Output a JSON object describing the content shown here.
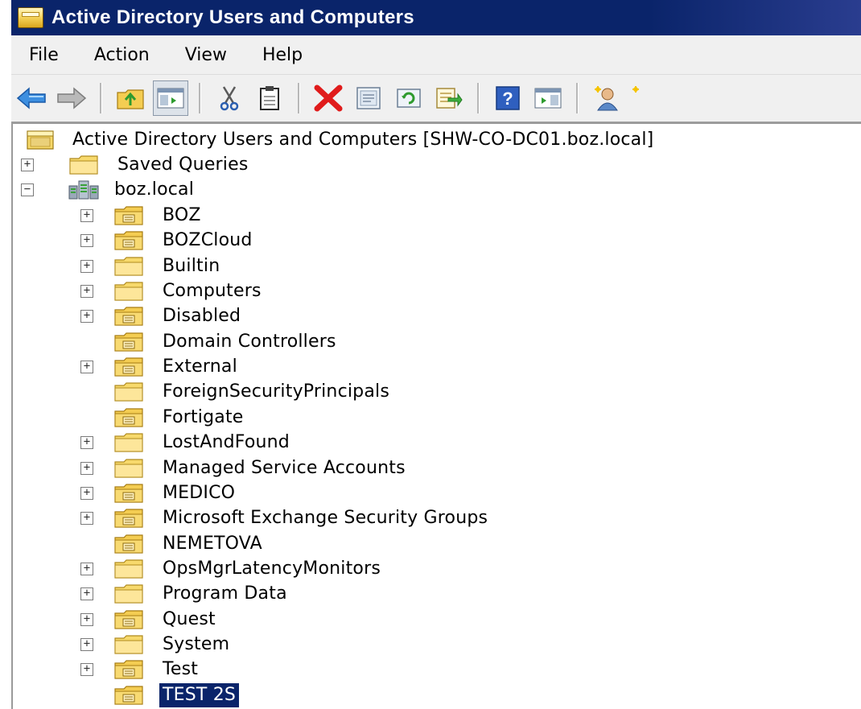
{
  "window": {
    "title": "Active Directory Users and Computers"
  },
  "menu": {
    "items": [
      "File",
      "Action",
      "View",
      "Help"
    ]
  },
  "toolbar": {
    "buttons": [
      {
        "name": "back-icon"
      },
      {
        "name": "forward-icon"
      },
      {
        "name": "up-folder-icon"
      },
      {
        "name": "show-hide-tree-icon"
      },
      {
        "name": "cut-icon"
      },
      {
        "name": "paste-icon"
      },
      {
        "name": "delete-icon"
      },
      {
        "name": "properties-icon"
      },
      {
        "name": "refresh-icon"
      },
      {
        "name": "export-list-icon"
      },
      {
        "name": "help-icon"
      },
      {
        "name": "show-action-pane-icon"
      },
      {
        "name": "new-user-icon"
      }
    ]
  },
  "tree": {
    "root": {
      "label": "Active Directory Users and Computers [SHW-CO-DC01.boz.local]"
    },
    "saved_queries": {
      "label": "Saved Queries",
      "expanded": false
    },
    "domain": {
      "label": "boz.local",
      "expanded": true
    },
    "children": [
      {
        "label": "BOZ",
        "kind": "ou",
        "expandable": true
      },
      {
        "label": "BOZCloud",
        "kind": "ou",
        "expandable": true
      },
      {
        "label": "Builtin",
        "kind": "container",
        "expandable": true
      },
      {
        "label": "Computers",
        "kind": "container",
        "expandable": true
      },
      {
        "label": "Disabled",
        "kind": "ou",
        "expandable": true
      },
      {
        "label": "Domain Controllers",
        "kind": "ou",
        "expandable": false
      },
      {
        "label": "External",
        "kind": "ou",
        "expandable": true
      },
      {
        "label": "ForeignSecurityPrincipals",
        "kind": "container",
        "expandable": false
      },
      {
        "label": "Fortigate",
        "kind": "ou",
        "expandable": false
      },
      {
        "label": "LostAndFound",
        "kind": "container",
        "expandable": true
      },
      {
        "label": "Managed Service Accounts",
        "kind": "container",
        "expandable": true
      },
      {
        "label": "MEDICO",
        "kind": "ou",
        "expandable": true
      },
      {
        "label": "Microsoft Exchange Security Groups",
        "kind": "ou",
        "expandable": true
      },
      {
        "label": "NEMETOVA",
        "kind": "ou",
        "expandable": false
      },
      {
        "label": "OpsMgrLatencyMonitors",
        "kind": "container",
        "expandable": true
      },
      {
        "label": "Program Data",
        "kind": "container",
        "expandable": true
      },
      {
        "label": "Quest",
        "kind": "ou",
        "expandable": true
      },
      {
        "label": "System",
        "kind": "container",
        "expandable": true
      },
      {
        "label": "Test",
        "kind": "ou",
        "expandable": true
      },
      {
        "label": "TEST 2S",
        "kind": "ou",
        "expandable": false,
        "selected": true
      }
    ]
  },
  "colors": {
    "titlebar": "#0a246a",
    "selection": "#0a246a",
    "folder": "#f7d76a"
  }
}
